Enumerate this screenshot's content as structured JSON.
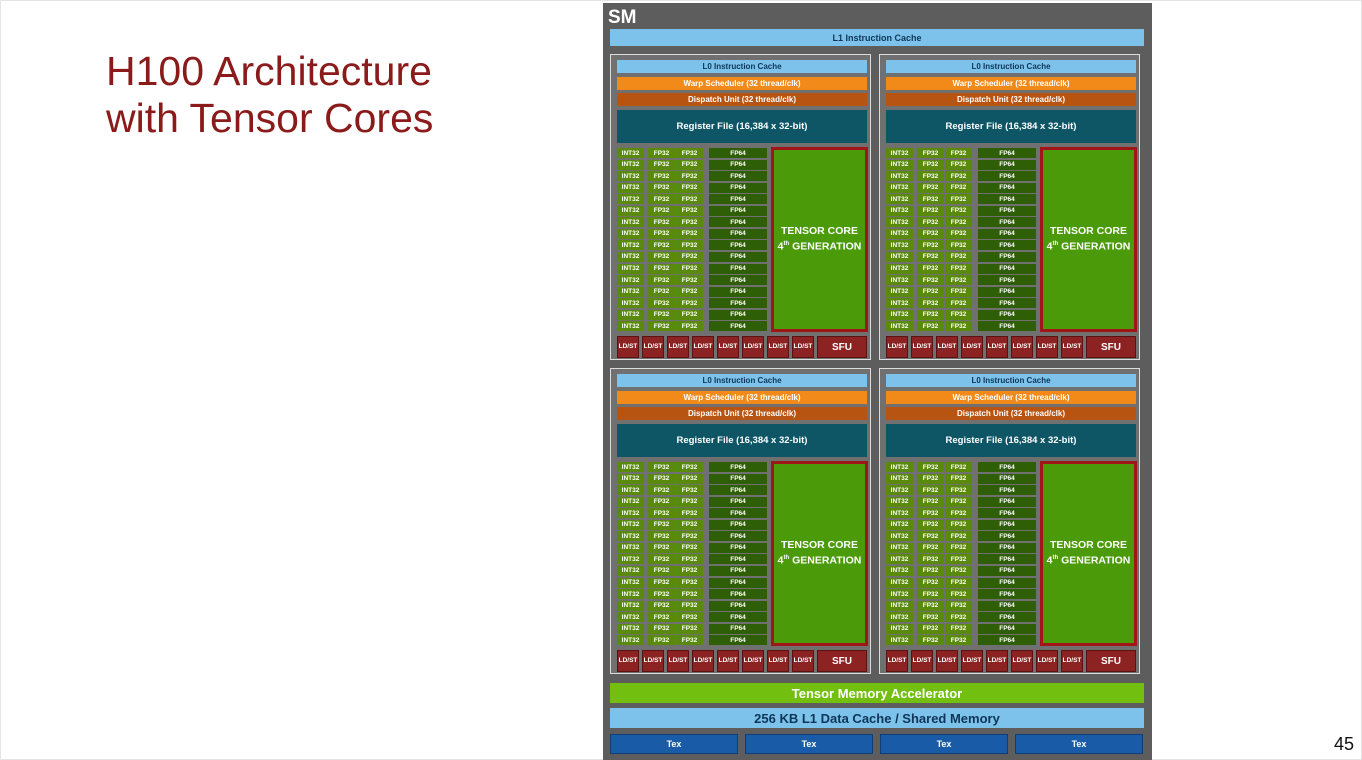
{
  "slide": {
    "title_lines": [
      "H100 Architecture",
      "with Tensor Cores"
    ],
    "page_number": "45"
  },
  "diagram": {
    "sm_label": "SM",
    "l1_instruction_cache": "L1 Instruction Cache",
    "tensor_memory_accelerator": "Tensor Memory Accelerator",
    "l1_data_cache": "256 KB L1 Data Cache / Shared Memory",
    "tex_units": [
      "Tex",
      "Tex",
      "Tex",
      "Tex"
    ],
    "quadrant": {
      "l0_cache": "L0 Instruction Cache",
      "warp_scheduler": "Warp Scheduler (32 thread/clk)",
      "dispatch_unit": "Dispatch Unit (32 thread/clk)",
      "register_file": "Register File (16,384 x 32-bit)",
      "int32": "INT32",
      "fp32": "FP32",
      "fp64": "FP64",
      "tensor_core_line1": "TENSOR CORE",
      "tensor_core_ordinal": "4",
      "tensor_core_suffix": "th",
      "tensor_core_line2": " GENERATION",
      "ldst_top": "LD/",
      "ldst_bottom": "ST",
      "sfu": "SFU"
    },
    "quadrant_count": 4,
    "core_rows_per_quadrant": 16,
    "ldst_units_per_quadrant": 8
  }
}
